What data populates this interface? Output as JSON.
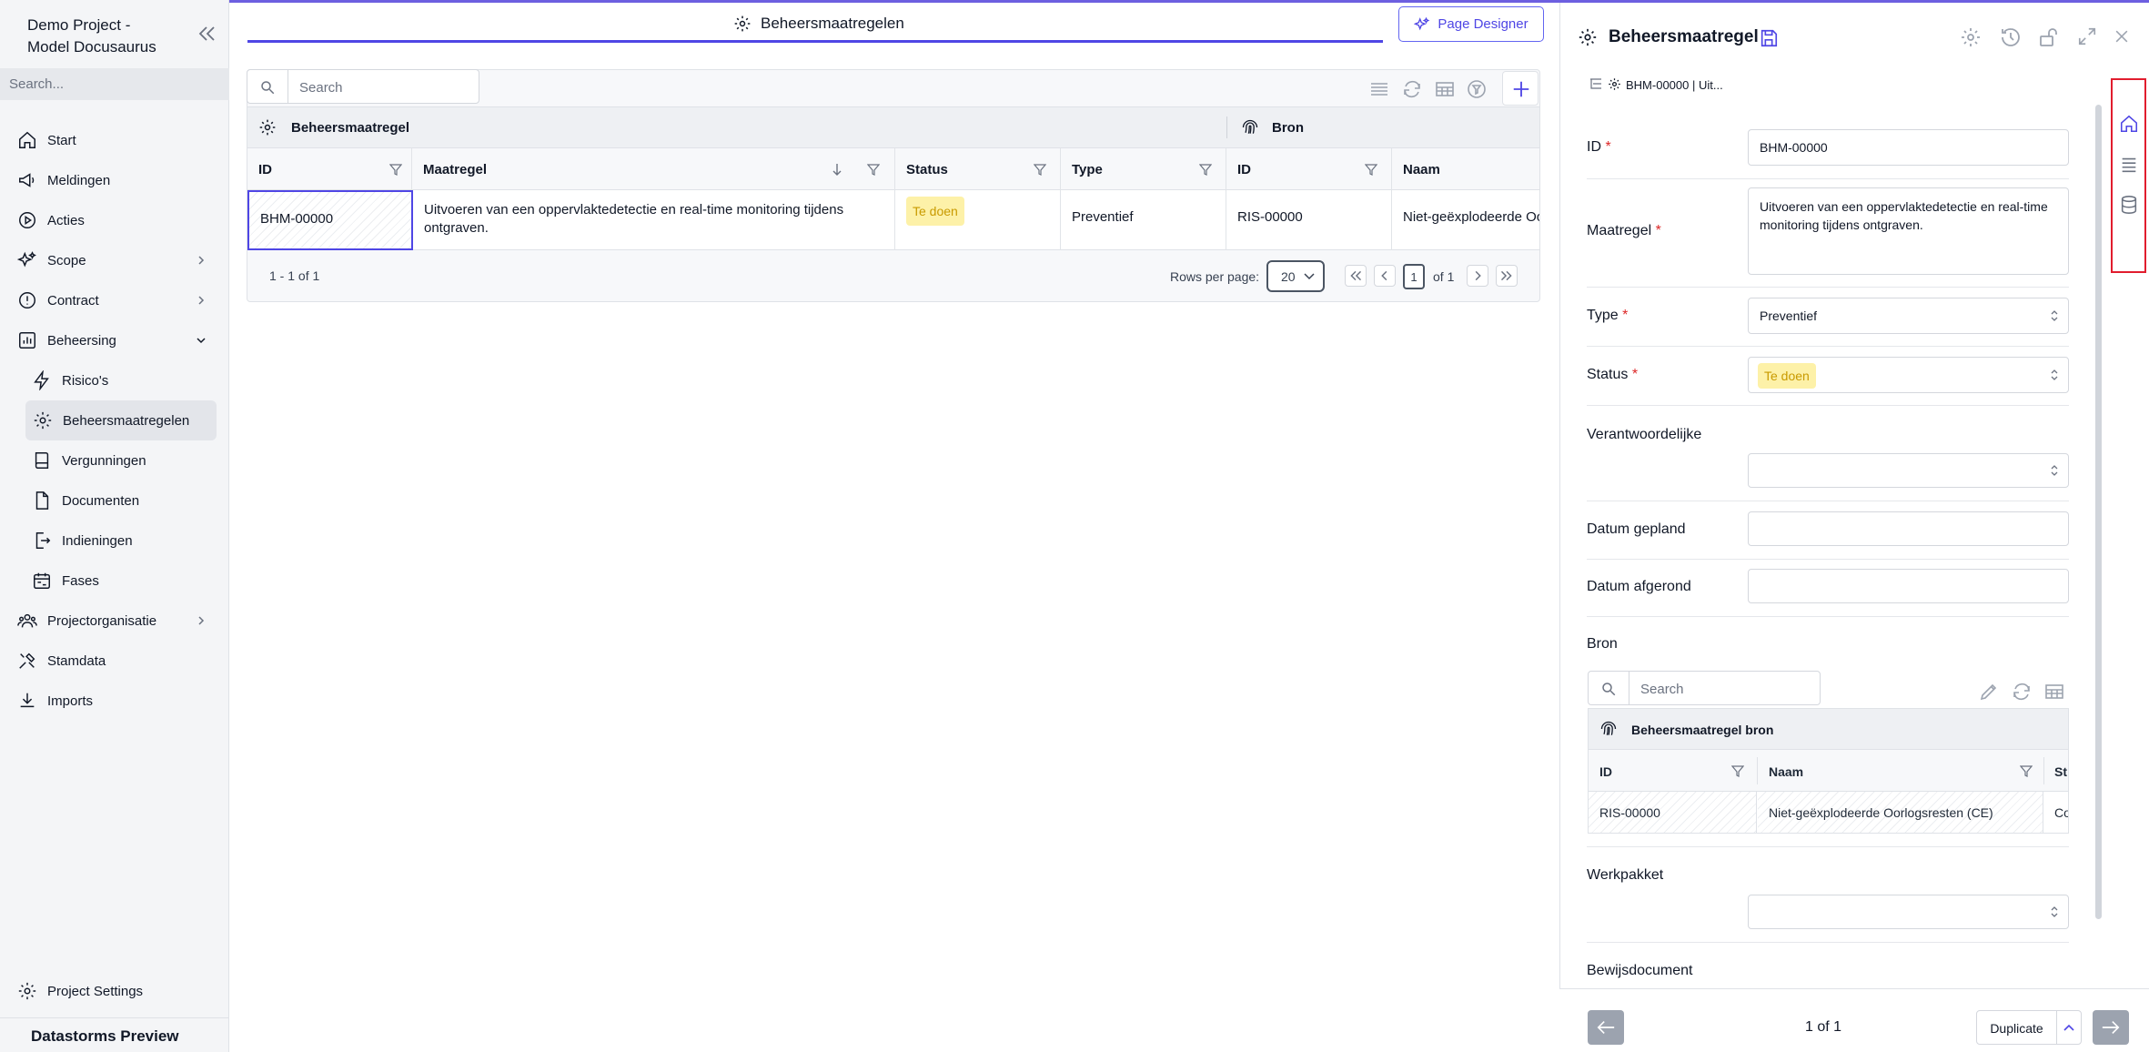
{
  "sidebar": {
    "project_line1": "Demo Project -",
    "project_line2": "Model Docusaurus",
    "search_placeholder": "Search...",
    "items": [
      {
        "label": "Start",
        "icon": "home-icon"
      },
      {
        "label": "Meldingen",
        "icon": "megaphone-icon"
      },
      {
        "label": "Acties",
        "icon": "play-circle-icon"
      },
      {
        "label": "Scope",
        "icon": "sparkles-icon"
      },
      {
        "label": "Contract",
        "icon": "alert-circle-icon"
      },
      {
        "label": "Beheersing",
        "icon": "bar-chart-icon"
      },
      {
        "label": "Risico's",
        "icon": "lightning-icon"
      },
      {
        "label": "Beheersmaatregelen",
        "icon": "gear-icon"
      },
      {
        "label": "Vergunningen",
        "icon": "book-icon"
      },
      {
        "label": "Documenten",
        "icon": "file-icon"
      },
      {
        "label": "Indieningen",
        "icon": "file-export-icon"
      },
      {
        "label": "Fases",
        "icon": "calendar-icon"
      },
      {
        "label": "Projectorganisatie",
        "icon": "people-icon"
      },
      {
        "label": "Stamdata",
        "icon": "tools-icon"
      },
      {
        "label": "Imports",
        "icon": "download-icon"
      }
    ],
    "project_settings": "Project Settings",
    "preview_label": "Datastorms Preview"
  },
  "main": {
    "tab_title": "Beheersmaatregelen",
    "page_designer": "Page Designer",
    "search_placeholder": "Search",
    "group_left": "Beheersmaatregel",
    "group_right": "Bron",
    "columns": [
      "ID",
      "Maatregel",
      "Status",
      "Type",
      "ID",
      "Naam"
    ],
    "row": {
      "id": "BHM-00000",
      "maatregel": "Uitvoeren van een oppervlaktedetectie en real-time monitoring tijdens ontgraven.",
      "status": "Te doen",
      "type": "Preventief",
      "bron_id": "RIS-00000",
      "bron_naam": "Niet-geëxplodeerde Oo"
    },
    "record_count": "1 - 1 of 1",
    "rows_per_page_label": "Rows per page:",
    "rows_per_page": "20",
    "page": "1",
    "page_of": "of 1"
  },
  "panel": {
    "title": "Beheersmaatregel",
    "breadcrumb": "BHM-00000 | Uit...",
    "fields": {
      "id_label": "ID",
      "id_value": "BHM-00000",
      "maatregel_label": "Maatregel",
      "maatregel_value": "Uitvoeren van een oppervlaktedetectie en real-time monitoring tijdens ontgraven.",
      "type_label": "Type",
      "type_value": "Preventief",
      "status_label": "Status",
      "status_value": "Te doen",
      "verantwoordelijke_label": "Verantwoordelijke",
      "datum_gepland_label": "Datum gepland",
      "datum_afgerond_label": "Datum afgerond",
      "bron_label": "Bron",
      "werkpakket_label": "Werkpakket",
      "bewijsdocument_label": "Bewijsdocument"
    },
    "bron_grid": {
      "search_placeholder": "Search",
      "group": "Beheersmaatregel bron",
      "columns": [
        "ID",
        "Naam",
        "St"
      ],
      "row": {
        "id": "RIS-00000",
        "naam": "Niet-geëxplodeerde Oorlogsresten (CE)",
        "extra": "Co"
      }
    },
    "pager": "1 of 1",
    "duplicate": "Duplicate"
  },
  "colors": {
    "accent": "#4f46e5",
    "badge_bg": "#fdf1a8",
    "badge_text": "#c99a00",
    "highlight": "#e11d2e"
  }
}
